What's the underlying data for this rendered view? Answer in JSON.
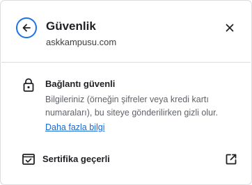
{
  "header": {
    "title": "Güvenlik",
    "domain": "askkampusu.com"
  },
  "connection": {
    "title": "Bağlantı güvenli",
    "description_lines": [
      "Bilgileriniz (örneğin şifreler veya kredi kartı",
      "numaraları), bu siteye gönderilirken gizli olur."
    ],
    "learn_more": "Daha fazla bilgi"
  },
  "certificate": {
    "label": "Sertifika geçerli"
  },
  "icons": {
    "back": "arrow-back-icon",
    "close": "close-icon",
    "lock": "lock-icon",
    "certificate": "certificate-icon",
    "external": "open-in-new-icon"
  },
  "colors": {
    "accent": "#1a73e8",
    "link": "#1967d2",
    "divider": "#dadce0"
  }
}
